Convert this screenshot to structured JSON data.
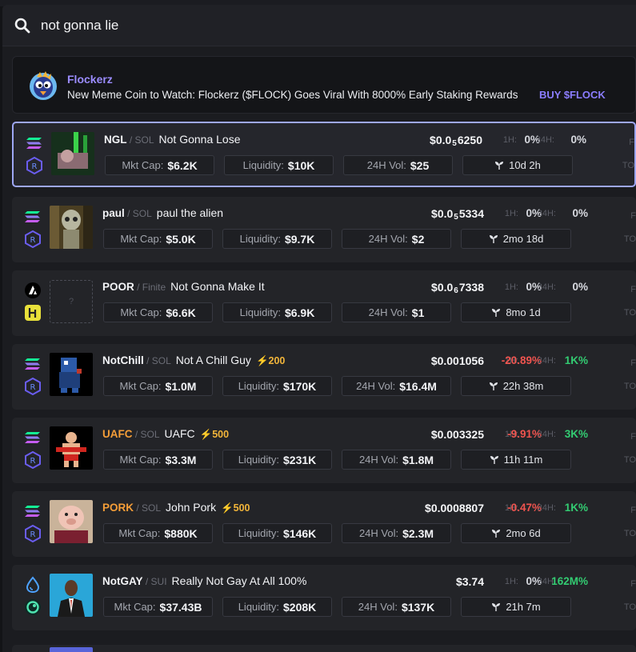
{
  "search": {
    "query": "not gonna lie"
  },
  "ad": {
    "name": "Flockerz",
    "text": "New Meme Coin to Watch: Flockerz ($FLOCK) Goes Viral With 8000% Early Staking Rewards",
    "cta": "BUY $FLOCK"
  },
  "labels": {
    "mkt_cap": "Mkt Cap:",
    "liquidity": "Liquidity:",
    "vol": "24H Vol:",
    "h1": "1H:",
    "h24": "24H:",
    "edge1": "F",
    "edge2": "TO"
  },
  "rows": [
    {
      "symbol": "NGL",
      "chain": "SOL",
      "name": "Not Gonna Lose",
      "boost": "",
      "price_prefix": "$0.0",
      "price_sub": "5",
      "price_digits": "6250",
      "price": "",
      "change_1h": "0%",
      "change_24h": "0%",
      "mkt_cap": "$6.2K",
      "liquidity": "$10K",
      "volume": "$25",
      "age": "10d 2h"
    },
    {
      "symbol": "paul",
      "chain": "SOL",
      "name": "paul the alien",
      "boost": "",
      "price_prefix": "$0.0",
      "price_sub": "5",
      "price_digits": "5334",
      "price": "",
      "change_1h": "0%",
      "change_24h": "0%",
      "mkt_cap": "$5.0K",
      "liquidity": "$9.7K",
      "volume": "$2",
      "age": "2mo 18d"
    },
    {
      "symbol": "POOR",
      "chain": "Finite",
      "name": "Not Gonna Make It",
      "boost": "",
      "price_prefix": "$0.0",
      "price_sub": "6",
      "price_digits": "7338",
      "price": "",
      "change_1h": "0%",
      "change_24h": "0%",
      "mkt_cap": "$6.6K",
      "liquidity": "$6.9K",
      "volume": "$1",
      "age": "8mo 1d",
      "thumb_placeholder": "?"
    },
    {
      "symbol": "NotChill",
      "chain": "SOL",
      "name": "Not A Chill Guy",
      "boost": "⚡200",
      "price": "$0.001056",
      "change_1h": "-20.89%",
      "change_24h": "1K%",
      "mkt_cap": "$1.0M",
      "liquidity": "$170K",
      "volume": "$16.4M",
      "age": "22h 38m"
    },
    {
      "symbol": "UAFC",
      "chain": "SOL",
      "name": "UAFC",
      "boost": "⚡500",
      "price": "$0.003325",
      "change_1h": "-9.91%",
      "change_24h": "3K%",
      "mkt_cap": "$3.3M",
      "liquidity": "$231K",
      "volume": "$1.8M",
      "age": "11h 11m"
    },
    {
      "symbol": "PORK",
      "chain": "SOL",
      "name": "John Pork",
      "boost": "⚡500",
      "price": "$0.0008807",
      "change_1h": "-0.47%",
      "change_24h": "1K%",
      "mkt_cap": "$880K",
      "liquidity": "$146K",
      "volume": "$2.3M",
      "age": "2mo 6d"
    },
    {
      "symbol": "NotGAY",
      "chain": "SUI",
      "name": "Really Not Gay At All 100%",
      "boost": "",
      "price": "$3.74",
      "change_1h": "0%",
      "change_24h": "162M%",
      "mkt_cap": "$37.43B",
      "liquidity": "$208K",
      "volume": "$137K",
      "age": "21h 7m"
    }
  ],
  "colors": {
    "accent": "#9b8cff",
    "positive": "#33cc72",
    "negative": "#f0544f",
    "boost": "#f2b53a",
    "selected_border": "#9ea7f5"
  }
}
